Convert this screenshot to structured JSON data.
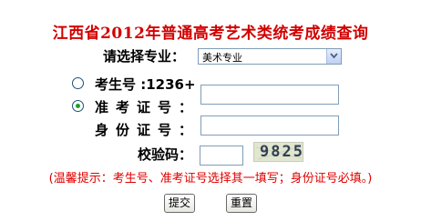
{
  "title": "江西省2012年普通高考艺术类统考成绩查询",
  "major": {
    "label": "请选择专业",
    "selected": "美术专业"
  },
  "exam_number": {
    "label": "考生号 :1236+",
    "selected": false
  },
  "admission_ticket": {
    "label": "准考证号",
    "selected": true
  },
  "id_card": {
    "label": "身份证号"
  },
  "captcha": {
    "label": "校验码",
    "image_text": "9825"
  },
  "hint": "(温馨提示：考生号、准考证号选择其一填写；身份证号必填。)",
  "buttons": {
    "submit": "提交",
    "reset": "重置"
  },
  "colors": {
    "title": "#d20000",
    "hint": "#e00000",
    "radio_checked": "#21a121"
  },
  "icons": {
    "dropdown": "chevron-down-icon",
    "radio": "radio-icon"
  }
}
